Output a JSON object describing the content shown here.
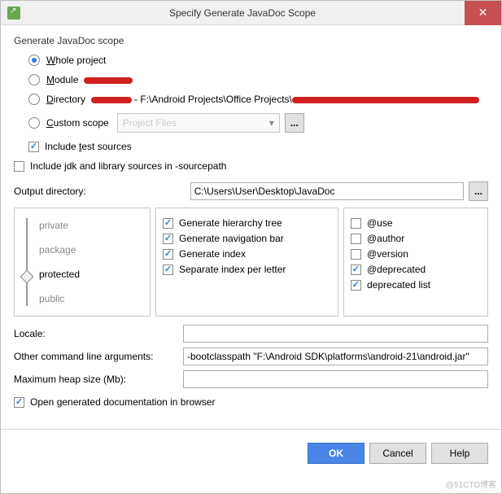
{
  "titlebar": {
    "title": "Specify Generate JavaDoc Scope"
  },
  "group": {
    "label": "Generate JavaDoc scope"
  },
  "scope": {
    "whole": "Whole project",
    "module_prefix": "Module",
    "directory_prefix": "Directory",
    "directory_path": "- F:\\Android Projects\\Office Projects\\",
    "custom": "Custom scope",
    "custom_placeholder": "Project Files",
    "include_tests": "Include test sources",
    "include_jdk": "Include jdk and library sources in -sourcepath"
  },
  "output": {
    "label": "Output directory:",
    "value": "C:\\Users\\User\\Desktop\\JavaDoc"
  },
  "slider": {
    "levels": [
      "private",
      "package",
      "protected",
      "public"
    ]
  },
  "gen": {
    "hierarchy": "Generate hierarchy tree",
    "navbar": "Generate navigation bar",
    "index": "Generate index",
    "separate": "Separate index per letter"
  },
  "tags": {
    "use": "@use",
    "author": "@author",
    "version": "@version",
    "deprecated": "@deprecated",
    "deplist": "deprecated list"
  },
  "extra": {
    "locale": "Locale:",
    "args_label": "Other command line arguments:",
    "args_value": "-bootclasspath \"F:\\Android SDK\\platforms\\android-21\\android.jar\"",
    "heap": "Maximum heap size (Mb):",
    "open_browser": "Open generated documentation in browser"
  },
  "buttons": {
    "ok": "OK",
    "cancel": "Cancel",
    "help": "Help"
  },
  "ellipsis": "...",
  "watermark": "@51CTO博客"
}
